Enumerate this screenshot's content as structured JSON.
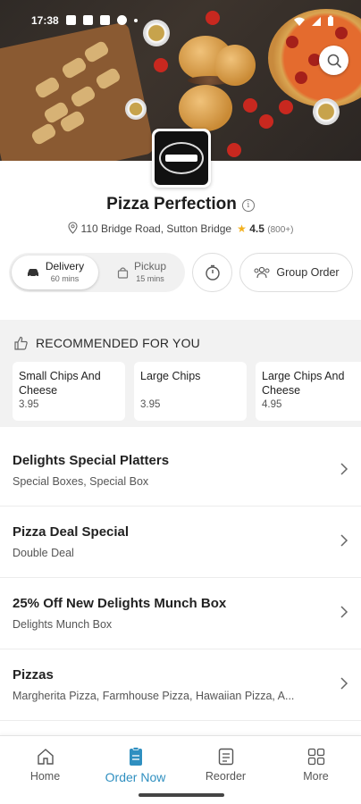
{
  "status_bar": {
    "time": "17:38"
  },
  "store": {
    "name": "Pizza Perfection",
    "address": "110 Bridge Road, Sutton Bridge",
    "rating": "4.5",
    "rating_count": "(800+)"
  },
  "order_types": {
    "delivery": {
      "label": "Delivery",
      "time": "60 mins"
    },
    "pickup": {
      "label": "Pickup",
      "time": "15 mins"
    },
    "group_order_label": "Group Order"
  },
  "recommended": {
    "heading": "RECOMMENDED FOR YOU",
    "items": [
      {
        "name": "Small Chips And Cheese",
        "price": "3.95"
      },
      {
        "name": "Large Chips",
        "price": "3.95"
      },
      {
        "name": "Large Chips And Cheese",
        "price": "4.95"
      }
    ]
  },
  "categories": [
    {
      "title": "Delights Special Platters",
      "subtitle": "Special Boxes, Special Box"
    },
    {
      "title": "Pizza Deal Special",
      "subtitle": "Double Deal"
    },
    {
      "title": "25% Off New Delights Munch Box",
      "subtitle": "Delights Munch Box"
    },
    {
      "title": "Pizzas",
      "subtitle": "Margherita Pizza, Farmhouse Pizza, Hawaiian Pizza, A..."
    }
  ],
  "bottom_nav": {
    "items": [
      {
        "label": "Home",
        "icon": "home-icon"
      },
      {
        "label": "Order Now",
        "icon": "order-icon"
      },
      {
        "label": "Reorder",
        "icon": "receipt-icon"
      },
      {
        "label": "More",
        "icon": "grid-icon"
      }
    ],
    "active": "Order Now"
  },
  "colors": {
    "accent": "#2f8fc0",
    "star": "#f2b01e"
  }
}
